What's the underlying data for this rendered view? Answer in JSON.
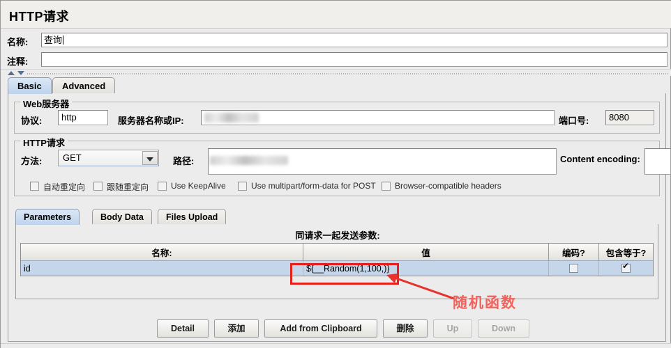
{
  "window": {
    "title": "HTTP请求"
  },
  "header": {
    "name_label": "名称:",
    "name_value": "查询",
    "comment_label": "注释:",
    "comment_value": ""
  },
  "main_tabs": [
    {
      "label": "Basic",
      "selected": true
    },
    {
      "label": "Advanced",
      "selected": false
    }
  ],
  "web_server": {
    "legend": "Web服务器",
    "protocol_label": "协议:",
    "protocol_value": "http",
    "server_label": "服务器名称或IP:",
    "server_value": "",
    "port_label": "端口号:",
    "port_value": "8080"
  },
  "http_request": {
    "legend": "HTTP请求",
    "method_label": "方法:",
    "method_value": "GET",
    "path_label": "路径:",
    "path_value": "",
    "content_encoding_label": "Content encoding:",
    "content_encoding_value": "",
    "checkboxes": [
      {
        "label": "自动重定向",
        "checked": false
      },
      {
        "label": "跟随重定向",
        "checked": false
      },
      {
        "label": "Use KeepAlive",
        "checked": false
      },
      {
        "label": "Use multipart/form-data for POST",
        "checked": false
      },
      {
        "label": "Browser-compatible headers",
        "checked": false
      }
    ]
  },
  "param_tabs": [
    {
      "label": "Parameters",
      "selected": true
    },
    {
      "label": "Body Data",
      "selected": false
    },
    {
      "label": "Files Upload",
      "selected": false
    }
  ],
  "param_table": {
    "caption": "同请求一起发送参数:",
    "columns": [
      "名称:",
      "值",
      "编码?",
      "包含等于?"
    ],
    "rows": [
      {
        "name": "id",
        "value": "${__Random(1,100,)}",
        "encode": false,
        "include_equals": true,
        "selected": true
      }
    ]
  },
  "annotation": {
    "text": "随机函数",
    "color": "#f0625c",
    "highlight_color": "#e8201b"
  },
  "buttons": [
    {
      "label": "Detail",
      "enabled": true
    },
    {
      "label": "添加",
      "enabled": true
    },
    {
      "label": "Add from Clipboard",
      "enabled": true
    },
    {
      "label": "删除",
      "enabled": true
    },
    {
      "label": "Up",
      "enabled": false
    },
    {
      "label": "Down",
      "enabled": false
    }
  ]
}
